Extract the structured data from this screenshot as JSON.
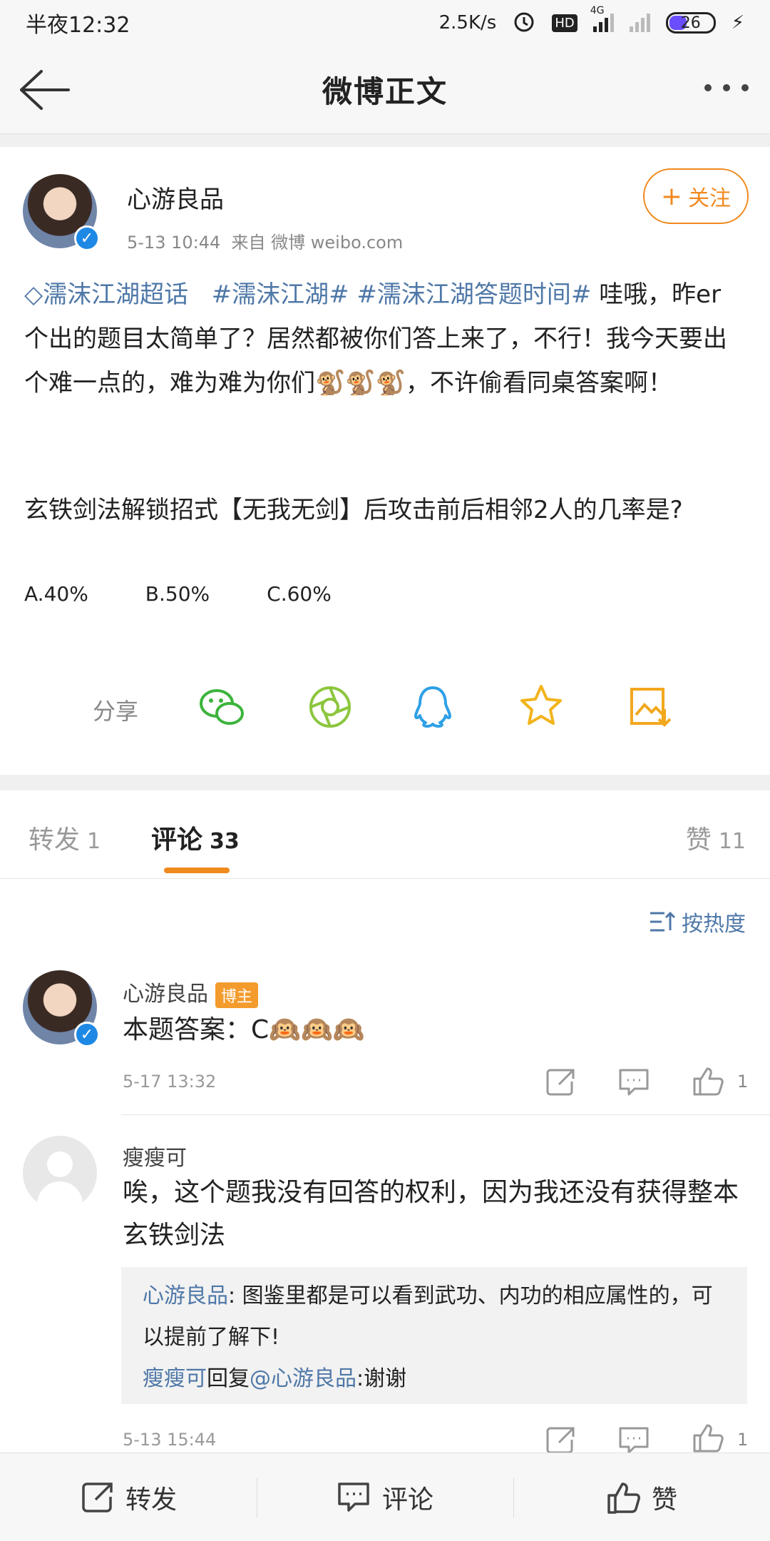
{
  "status_bar": {
    "time": "半夜12:32",
    "speed": "2.5K/s",
    "hd": "HD",
    "net": "4G",
    "battery": "26"
  },
  "nav": {
    "title": "微博正文"
  },
  "post": {
    "author": "心游良品",
    "follow_label": "关注",
    "time": "5-13 10:44",
    "source": "来自 微博 weibo.com",
    "super_topic": "濡沫江湖超话",
    "tag1": "#濡沫江湖#",
    "tag2": "#濡沫江湖答题时间#",
    "body": "哇哦，昨er个出的题目太简单了？居然都被你们答上来了，不行！我今天要出个难一点的，难为难为你们",
    "body_tail": "，不许偷看同桌答案啊！",
    "question": "玄铁剑法解锁招式【无我无剑】后攻击前后相邻2人的几率是?",
    "options": [
      "A.40%",
      "B.50%",
      "C.60%"
    ],
    "share_label": "分享"
  },
  "tabs": {
    "repost": {
      "label": "转发",
      "count": "1"
    },
    "comment": {
      "label": "评论",
      "count": "33"
    },
    "like": {
      "label": "赞",
      "count": "11"
    }
  },
  "sort_label": "按热度",
  "comments": [
    {
      "name": "心游良品",
      "badge": "博主",
      "text": "本题答案：C",
      "time": "5-17 13:32",
      "likes": "1"
    },
    {
      "name": "瘦瘦可",
      "text": "唉，这个题我没有回答的权利，因为我还没有获得整本玄铁剑法",
      "reply_author": "心游良品",
      "reply_text": ": 图鉴里都是可以看到武功、内功的相应属性的，可以提前了解下!",
      "reply2_author": "瘦瘦可",
      "reply2_mid": "回复",
      "reply2_target": "@心游良品",
      "reply2_text": ":谢谢",
      "time": "5-13 15:44",
      "likes": "1"
    }
  ],
  "bottom_bar": {
    "repost": "转发",
    "comment": "评论",
    "like": "赞"
  }
}
